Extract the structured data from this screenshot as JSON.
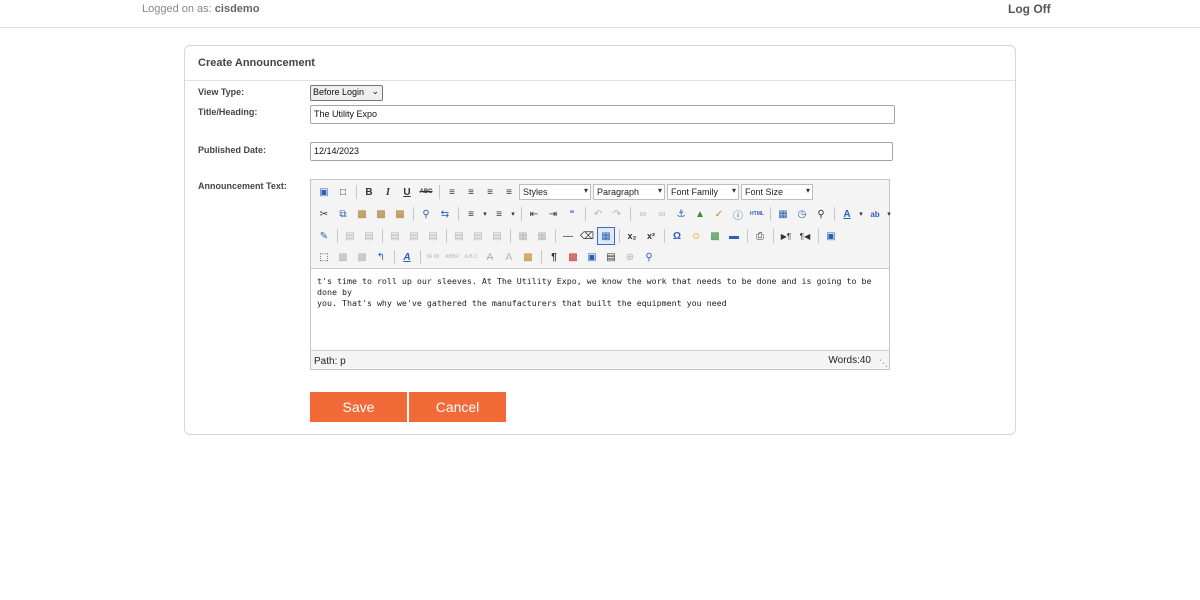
{
  "header": {
    "logged_prefix": "Logged on as: ",
    "username": "cisdemo",
    "logoff": "Log Off"
  },
  "panel": {
    "title": "Create Announcement",
    "view_type_label": "View Type:",
    "view_type_value": "Before Login",
    "title_label": "Title/Heading:",
    "title_value": "The Utility Expo",
    "date_label": "Published Date:",
    "date_value": "12/14/2023",
    "text_label": "Announcement Text:"
  },
  "editor": {
    "dropdowns": {
      "styles": "Styles",
      "format": "Paragraph",
      "font_family": "Font Family",
      "font_size": "Font Size"
    },
    "content_line1": "t's time to roll up our sleeves. At The Utility Expo, we know the work that needs to be done and is going to be done by",
    "content_line2": "you. That's why we've gathered the manufacturers that built the equipment you need",
    "path": "Path: p",
    "words": "Words:40"
  },
  "buttons": {
    "save": "Save",
    "cancel": "Cancel"
  },
  "colors": {
    "accent": "#f26a37"
  }
}
